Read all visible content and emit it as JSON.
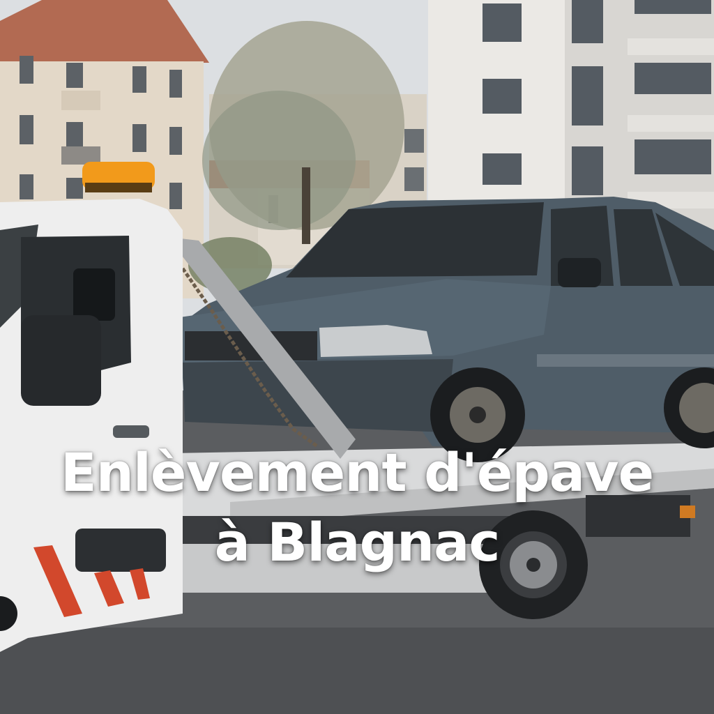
{
  "headline": {
    "line1": "Enlèvement d'épave",
    "line2": "à Blagnac"
  },
  "colors": {
    "sky": "#dcdfe2",
    "road": "#5b5d60",
    "truck_white": "#eeeeee",
    "car_body": "#4f5d68",
    "beacon": "#f29a1b",
    "text": "#ffffff"
  }
}
